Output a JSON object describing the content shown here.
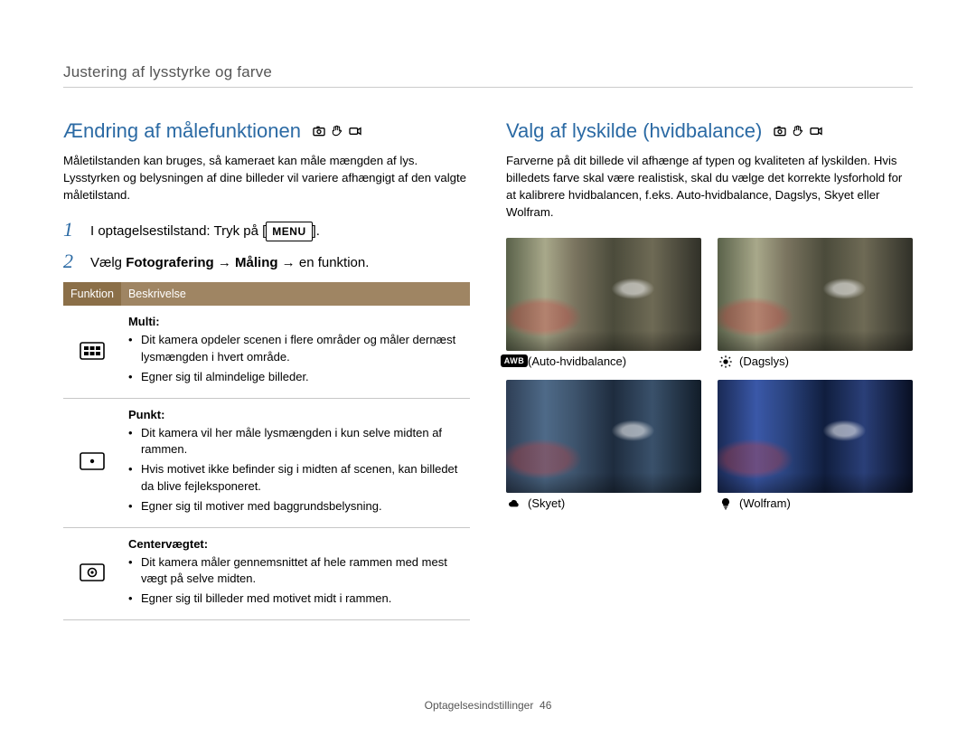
{
  "breadcrumb": "Justering af lysstyrke og farve",
  "left": {
    "title": "Ændring af målefunktionen",
    "intro": "Måletilstanden kan bruges, så kameraet kan måle mængden af lys. Lysstyrken og belysningen af dine billeder vil variere afhængigt af den valgte måletilstand.",
    "step1_prefix": "I optagelsestilstand: Tryk på [",
    "step1_badge": "MENU",
    "step1_suffix": "].",
    "step2_prefix": "Vælg ",
    "step2_bold": "Fotografering → Måling",
    "step2_suffix": " → en funktion.",
    "th_function": "Funktion",
    "th_desc": "Beskrivelse",
    "rows": [
      {
        "name": "Multi",
        "bullets": [
          "Dit kamera opdeler scenen i flere områder og måler dernæst lysmængden i hvert område.",
          "Egner sig til almindelige billeder."
        ]
      },
      {
        "name": "Punkt",
        "bullets": [
          "Dit kamera vil her måle lysmængden i kun selve midten af rammen.",
          "Hvis motivet ikke befinder sig i midten af scenen, kan billedet da blive fejleksponeret.",
          "Egner sig til motiver med baggrundsbelysning."
        ]
      },
      {
        "name": "Centervægtet",
        "bullets": [
          "Dit kamera måler gennemsnittet af hele rammen med mest vægt på selve midten.",
          "Egner sig til billeder med motivet midt i rammen."
        ]
      }
    ]
  },
  "right": {
    "title": "Valg af lyskilde (hvidbalance)",
    "intro": "Farverne på dit billede vil afhænge af typen og kvaliteten af lyskilden. Hvis billedets farve skal være realistisk, skal du vælge det korrekte lysforhold for at kalibrere hvidbalancen, f.eks. Auto-hvidbalance, Dagslys, Skyet eller Wolfram.",
    "wb": [
      {
        "key": "awb",
        "label": "(Auto-hvidbalance)"
      },
      {
        "key": "daylight",
        "label": "(Dagslys)"
      },
      {
        "key": "cloudy",
        "label": "(Skyet)"
      },
      {
        "key": "tungsten",
        "label": "(Wolfram)"
      }
    ]
  },
  "footer_label": "Optagelsesindstillinger",
  "footer_page": "46"
}
